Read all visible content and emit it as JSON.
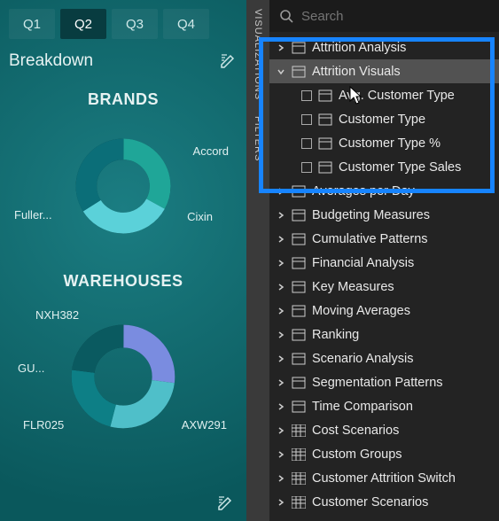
{
  "report": {
    "tabs": [
      "Q1",
      "Q2",
      "Q3",
      "Q4"
    ],
    "active_tab": 1,
    "breakdown_title": "Breakdown",
    "brands": {
      "title": "BRANDS",
      "labels": {
        "top_right": "Accord",
        "left": "Fuller...",
        "bottom_right": "Cixin"
      }
    },
    "warehouses": {
      "title": "WAREHOUSES",
      "labels": {
        "top_left": "NXH382",
        "left": "GU...",
        "bottom_left": "FLR025",
        "bottom_right": "AXW291"
      }
    }
  },
  "panel": {
    "rail": {
      "visualizations": "VISUALIZATIONS",
      "filters": "FILTERS"
    },
    "search_placeholder": "Search",
    "tree": [
      {
        "type": "group",
        "expanded": false,
        "icon": "measure-group",
        "label": "Attrition Analysis"
      },
      {
        "type": "group",
        "expanded": true,
        "icon": "measure-group",
        "label": "Attrition Visuals",
        "selected": true,
        "children": [
          {
            "label": "Avg. Customer Type"
          },
          {
            "label": "Customer Type"
          },
          {
            "label": "Customer Type %"
          },
          {
            "label": "Customer Type Sales"
          }
        ]
      },
      {
        "type": "group",
        "expanded": false,
        "icon": "measure-group",
        "label": "Averages per Day"
      },
      {
        "type": "group",
        "expanded": false,
        "icon": "measure-group",
        "label": "Budgeting Measures"
      },
      {
        "type": "group",
        "expanded": false,
        "icon": "measure-group",
        "label": "Cumulative Patterns"
      },
      {
        "type": "group",
        "expanded": false,
        "icon": "measure-group",
        "label": "Financial Analysis"
      },
      {
        "type": "group",
        "expanded": false,
        "icon": "measure-group",
        "label": "Key Measures"
      },
      {
        "type": "group",
        "expanded": false,
        "icon": "measure-group",
        "label": "Moving Averages"
      },
      {
        "type": "group",
        "expanded": false,
        "icon": "measure-group",
        "label": "Ranking"
      },
      {
        "type": "group",
        "expanded": false,
        "icon": "measure-group",
        "label": "Scenario Analysis"
      },
      {
        "type": "group",
        "expanded": false,
        "icon": "measure-group",
        "label": "Segmentation Patterns"
      },
      {
        "type": "group",
        "expanded": false,
        "icon": "measure-group",
        "label": "Time Comparison"
      },
      {
        "type": "group",
        "expanded": false,
        "icon": "table",
        "label": "Cost Scenarios"
      },
      {
        "type": "group",
        "expanded": false,
        "icon": "table",
        "label": "Custom Groups"
      },
      {
        "type": "group",
        "expanded": false,
        "icon": "table",
        "label": "Customer Attrition Switch"
      },
      {
        "type": "group",
        "expanded": false,
        "icon": "table",
        "label": "Customer Scenarios"
      }
    ]
  },
  "chart_data": [
    {
      "type": "pie",
      "title": "BRANDS",
      "series": [
        {
          "name": "Accord",
          "value": 33
        },
        {
          "name": "Cixin",
          "value": 33
        },
        {
          "name": "Fuller...",
          "value": 34
        }
      ],
      "inner_radius_pct": 55
    },
    {
      "type": "pie",
      "title": "WAREHOUSES",
      "series": [
        {
          "name": "NXH382",
          "value": 27
        },
        {
          "name": "AXW291",
          "value": 27
        },
        {
          "name": "FLR025",
          "value": 23
        },
        {
          "name": "GU...",
          "value": 23
        }
      ],
      "inner_radius_pct": 55
    }
  ]
}
